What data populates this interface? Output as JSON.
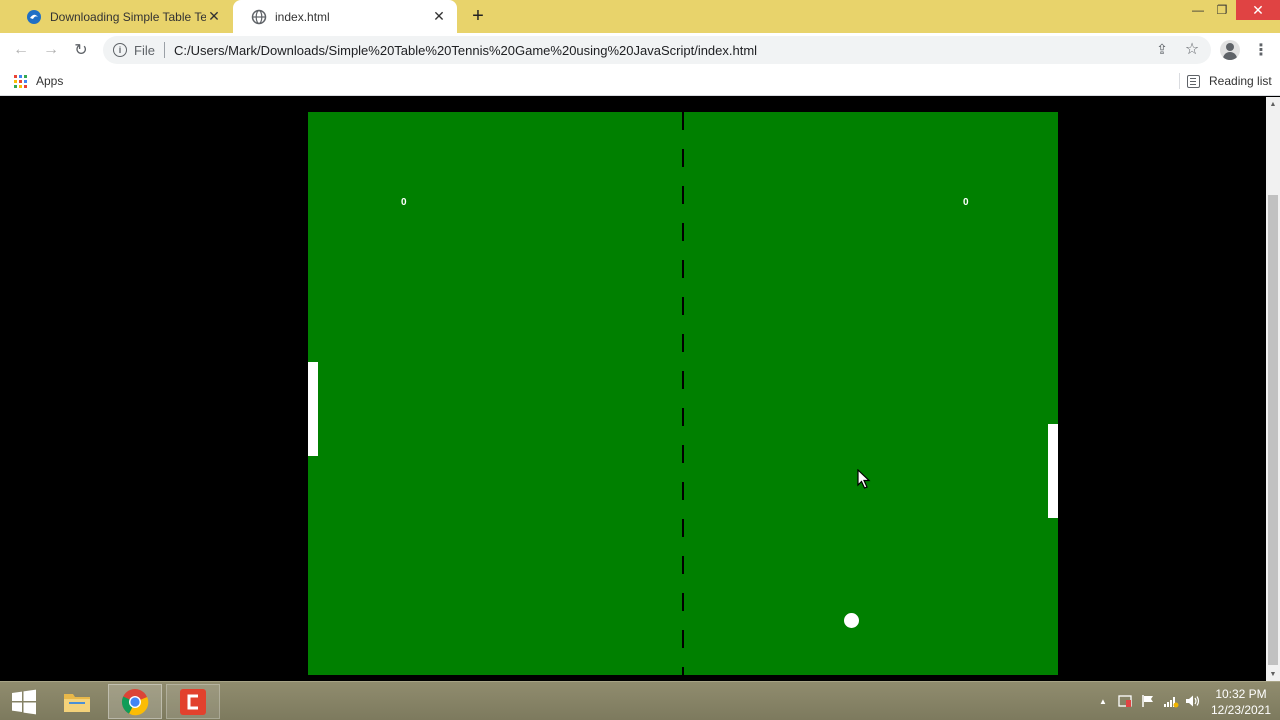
{
  "window": {
    "tabs": [
      {
        "title": "Downloading Simple Table Tenni",
        "active": false
      },
      {
        "title": "index.html",
        "active": true
      }
    ],
    "new_tab_glyph": "+",
    "controls": {
      "minimize": "—",
      "restore": "❐",
      "close": "✕"
    }
  },
  "toolbar": {
    "back_glyph": "←",
    "forward_glyph": "→",
    "reload_glyph": "↻",
    "info_glyph": "i",
    "scheme_label": "File",
    "url": "C:/Users/Mark/Downloads/Simple%20Table%20Tennis%20Game%20using%20JavaScript/index.html",
    "share_glyph": "⇪",
    "star_glyph": "☆",
    "menu_glyph": "⋮"
  },
  "bookmarks": {
    "apps_label": "Apps",
    "reading_list_label": "Reading list",
    "apps_colors": [
      "#ea4335",
      "#4285f4",
      "#34a853",
      "#fbbc05",
      "#ea4335",
      "#4285f4",
      "#34a853",
      "#fbbc05",
      "#ea4335"
    ]
  },
  "game": {
    "score_left": "0",
    "score_right": "0",
    "table_color": "#008000",
    "net_color": "#000000",
    "paddle_color": "#ffffff",
    "ball_color": "#ffffff"
  },
  "scrollbar": {
    "up_glyph": "▲",
    "down_glyph": "▼"
  },
  "taskbar": {
    "apps": [
      "windows-start",
      "file-explorer",
      "chrome",
      "camtasia"
    ],
    "tray_up_glyph": "▲",
    "time": "10:32 PM",
    "date": "12/23/2021"
  }
}
